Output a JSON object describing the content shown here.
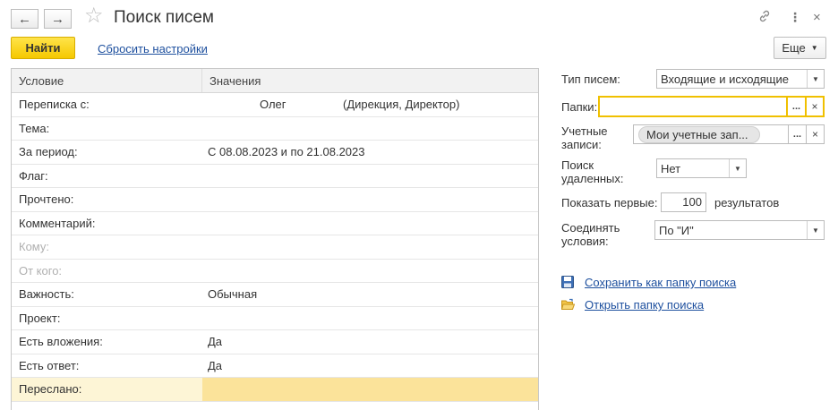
{
  "window": {
    "title": "Поиск писем"
  },
  "toolbar": {
    "find_label": "Найти",
    "reset_label": "Сбросить настройки",
    "more_label": "Еще"
  },
  "table": {
    "columns": [
      "Условие",
      "Значения"
    ],
    "rows": [
      {
        "condition": "Переписка с:",
        "value": "Олег",
        "value_extra": "(Дирекция, Директор)"
      },
      {
        "condition": "Тема:",
        "value": ""
      },
      {
        "condition": "За период:",
        "value": "С 08.08.2023 и по 21.08.2023"
      },
      {
        "condition": "Флаг:",
        "value": ""
      },
      {
        "condition": "Прочтено:",
        "value": ""
      },
      {
        "condition": "Комментарий:",
        "value": ""
      },
      {
        "condition": "Кому:",
        "value": ""
      },
      {
        "condition": "От кого:",
        "value": ""
      },
      {
        "condition": "Важность:",
        "value": "Обычная"
      },
      {
        "condition": "Проект:",
        "value": ""
      },
      {
        "condition": "Есть вложения:",
        "value": "Да"
      },
      {
        "condition": "Есть ответ:",
        "value": "Да"
      },
      {
        "condition": "Переслано:",
        "value": ""
      }
    ]
  },
  "panel": {
    "mail_type_label": "Тип писем:",
    "mail_type_value": "Входящие и исходящие",
    "folders_label": "Папки:",
    "folders_value": "",
    "accounts_label_1": "Учетные",
    "accounts_label_2": "записи:",
    "accounts_value": "Мои учетные зап...",
    "deleted_label_1": "Поиск",
    "deleted_label_2": "удаленных:",
    "deleted_value": "Нет",
    "show_first_label": "Показать первые:",
    "show_first_value": "100",
    "results_label": "результатов",
    "combine_label_1": "Соединять",
    "combine_label_2": "условия:",
    "combine_value": "По \"И\"",
    "save_folder_link": "Сохранить как папку поиска",
    "open_folder_link": "Открыть папку поиска",
    "ellipsis": "...",
    "clear": "×"
  },
  "colors": {
    "accent_yellow": "#f5c800",
    "link_blue": "#1d4f9e",
    "focus_border": "#f0c000",
    "selected_row": "#fbe39a"
  }
}
